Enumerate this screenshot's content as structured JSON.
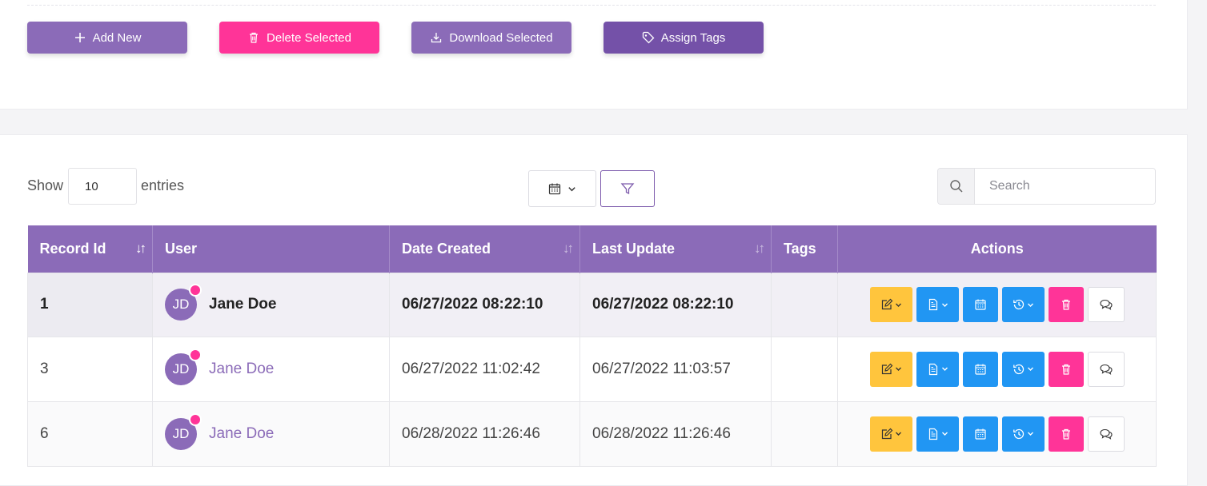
{
  "toolbar": {
    "add_label": "Add New",
    "delete_label": "Delete Selected",
    "download_label": "Download Selected",
    "tags_label": "Assign Tags"
  },
  "controls": {
    "show_label": "Show",
    "entries_value": "10",
    "entries_label": "entries",
    "search_placeholder": "Search"
  },
  "table": {
    "headers": [
      "Record Id",
      "User",
      "Date Created",
      "Last Update",
      "Tags",
      "Actions"
    ],
    "rows": [
      {
        "id": "1",
        "initials": "JD",
        "user": "Jane Doe",
        "created": "06/27/2022 08:22:10",
        "updated": "06/27/2022 08:22:10",
        "tags": ""
      },
      {
        "id": "3",
        "initials": "JD",
        "user": "Jane Doe",
        "created": "06/27/2022 11:02:42",
        "updated": "06/27/2022 11:03:57",
        "tags": ""
      },
      {
        "id": "6",
        "initials": "JD",
        "user": "Jane Doe",
        "created": "06/28/2022 11:26:46",
        "updated": "06/28/2022 11:26:46",
        "tags": ""
      }
    ]
  },
  "colors": {
    "primary": "#8b6bb8",
    "pink": "#ff3498",
    "warning": "#ffc53d",
    "info": "#2196f3"
  }
}
